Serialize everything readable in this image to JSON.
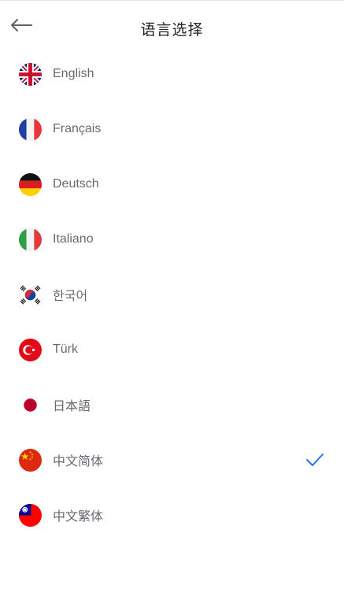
{
  "header": {
    "title": "语言选择",
    "back_icon": "arrow-left-icon"
  },
  "languages": [
    {
      "label": "English",
      "flag": "uk-flag-icon",
      "selected": false
    },
    {
      "label": "Français",
      "flag": "france-flag-icon",
      "selected": false
    },
    {
      "label": "Deutsch",
      "flag": "germany-flag-icon",
      "selected": false
    },
    {
      "label": "Italiano",
      "flag": "italy-flag-icon",
      "selected": false
    },
    {
      "label": "한국어",
      "flag": "korea-flag-icon",
      "selected": false
    },
    {
      "label": "Türk",
      "flag": "turkey-flag-icon",
      "selected": false
    },
    {
      "label": "日本語",
      "flag": "japan-flag-icon",
      "selected": false
    },
    {
      "label": "中文简体",
      "flag": "china-flag-icon",
      "selected": true
    },
    {
      "label": "中文繁体",
      "flag": "taiwan-flag-icon",
      "selected": false
    }
  ],
  "colors": {
    "accent": "#2d6df6",
    "label_text": "#666a70",
    "title_text": "#222222"
  }
}
